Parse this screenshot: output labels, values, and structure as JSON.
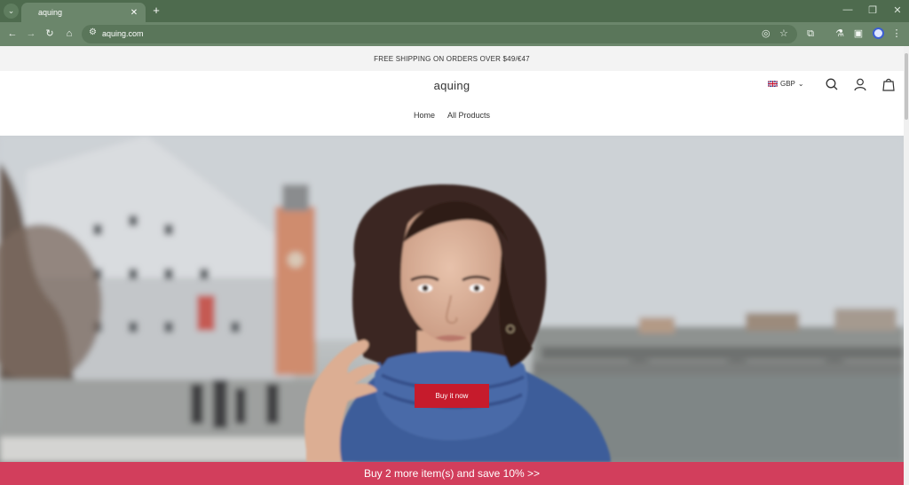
{
  "browser": {
    "tab_title": "aquing",
    "url": "aquing.com",
    "icons": [
      "tab-search-icon",
      "close-icon",
      "plus-icon",
      "minimize-icon",
      "restore-icon",
      "window-close-icon",
      "back-icon",
      "forward-icon",
      "reload-icon",
      "home-icon",
      "site-info-icon",
      "eye-off-icon",
      "star-icon",
      "extensions-icon",
      "labs-icon",
      "side-panel-icon",
      "profile-icon",
      "kebab-menu-icon"
    ]
  },
  "announcement": {
    "text": "FREE SHIPPING ON ORDERS OVER $49/€47"
  },
  "header": {
    "logo": "aquing",
    "currency": "GBP",
    "nav": [
      "Home",
      "All Products"
    ]
  },
  "hero": {
    "button_label": "Buy it now"
  },
  "promo": {
    "text": "Buy 2 more item(s) and save 10%  >>"
  },
  "colors": {
    "browser_frame": "#4e6b4e",
    "button_red": "#c61b2c",
    "promo_pink": "#d23e5c"
  }
}
